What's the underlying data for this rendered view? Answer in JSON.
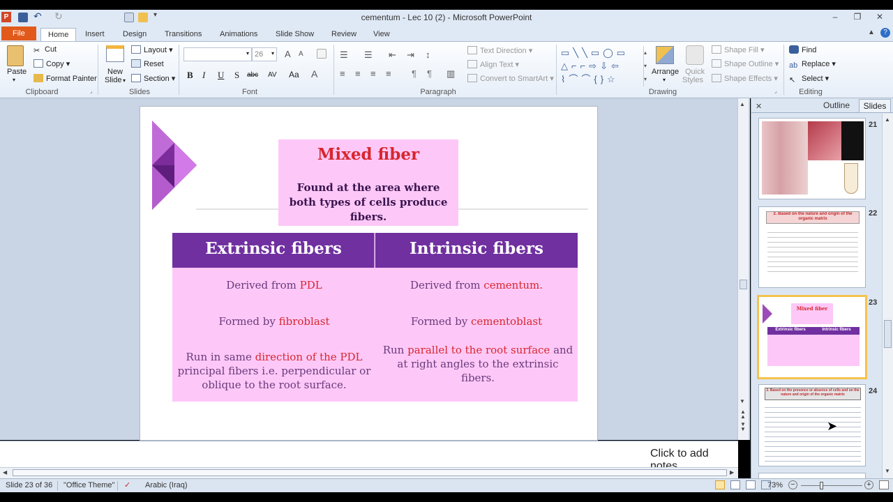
{
  "window": {
    "title": "cementum - Lec 10 (2)  -  Microsoft PowerPoint",
    "minimize": "–",
    "restore": "❐",
    "close": "✕"
  },
  "tabs": [
    "File",
    "Home",
    "Insert",
    "Design",
    "Transitions",
    "Animations",
    "Slide Show",
    "Review",
    "View"
  ],
  "ribbon": {
    "clipboard": {
      "paste": "Paste",
      "cut": "Cut",
      "copy": "Copy",
      "format_painter": "Format Painter",
      "label": "Clipboard"
    },
    "slides": {
      "new_slide_1": "New",
      "new_slide_2": "Slide",
      "layout": "Layout",
      "reset": "Reset",
      "section": "Section",
      "label": "Slides"
    },
    "font": {
      "font_name": "",
      "font_size": "26",
      "bold": "B",
      "italic": "I",
      "underline": "U",
      "shadow": "S",
      "strike": "abc",
      "spacing": "AV",
      "case": "Aa",
      "color": "A",
      "grow": "A",
      "shrink": "A",
      "label": "Font"
    },
    "paragraph": {
      "text_direction": "Text Direction",
      "align_text": "Align Text",
      "convert_smartart": "Convert to SmartArt",
      "label": "Paragraph"
    },
    "drawing": {
      "arrange": "Arrange",
      "quick_styles_1": "Quick",
      "quick_styles_2": "Styles",
      "shape_fill": "Shape Fill",
      "shape_outline": "Shape Outline",
      "shape_effects": "Shape Effects",
      "label": "Drawing"
    },
    "editing": {
      "find": "Find",
      "replace": "Replace",
      "select": "Select",
      "label": "Editing"
    }
  },
  "slide": {
    "title": "Mixed fiber",
    "subtitle": "Found  at the area where both types of cells produce fibers.",
    "headers": [
      "Extrinsic fibers",
      "Intrinsic fibers"
    ],
    "rows": [
      {
        "left": [
          "Derived from ",
          "PDL",
          ""
        ],
        "right": [
          "Derived from ",
          "cementum.",
          ""
        ]
      },
      {
        "left": [
          "Formed by ",
          "fibroblast",
          ""
        ],
        "right": [
          "Formed by ",
          "cementoblast",
          ""
        ]
      },
      {
        "left": [
          "Run in same ",
          "direction of the    PDL",
          " principal fibers i.e. perpendicular or oblique to the root surface."
        ],
        "right": [
          "Run ",
          "parallel to the root    surface",
          " and at right angles to the extrinsic fibers."
        ]
      }
    ]
  },
  "notes_placeholder": "Click to add notes",
  "panel": {
    "tab_outline": "Outline",
    "tab_slides": "Slides",
    "close": "✕",
    "thumbs": [
      {
        "num": "21"
      },
      {
        "num": "22",
        "heading": "2. Based on the nature and origin of the organic matrix"
      },
      {
        "num": "23",
        "title": "Mixed fiber",
        "left": "Extrinsic fibers",
        "right": "Intrinsic fibers"
      },
      {
        "num": "24",
        "heading": "2. Based on the presence or absence of cells and on the nature and origin of the organic matrix"
      }
    ]
  },
  "status": {
    "slide_info": "Slide 23 of 36",
    "theme": "\"Office Theme\"",
    "language": "Arabic (Iraq)",
    "zoom": "73%"
  },
  "colors": {
    "accent": "#7030a0",
    "pink": "#fdc8f7",
    "red": "#d8262f",
    "file_tab": "#e25a1b"
  }
}
